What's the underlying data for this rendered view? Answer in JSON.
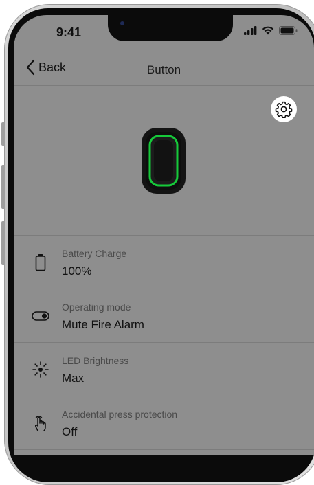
{
  "status_bar": {
    "time": "9:41"
  },
  "nav": {
    "back_label": "Back",
    "title": "Button"
  },
  "settings_rows": [
    {
      "label": "Battery Charge",
      "value": "100%",
      "icon": "battery-icon"
    },
    {
      "label": "Operating mode",
      "value": "Mute Fire Alarm",
      "icon": "toggle-icon"
    },
    {
      "label": "LED Brightness",
      "value": "Max",
      "icon": "brightness-icon"
    },
    {
      "label": "Accidental press protection",
      "value": "Off",
      "icon": "press-hand-icon"
    }
  ],
  "colors": {
    "screen_bg": "#8e8e8e",
    "led_ring": "#16c93a",
    "device_body": "#121212"
  }
}
